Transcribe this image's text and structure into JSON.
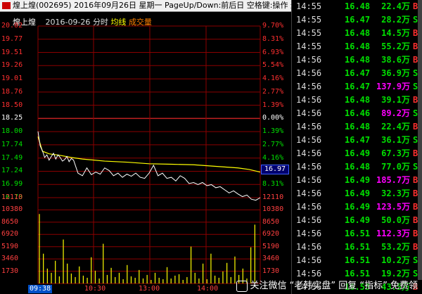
{
  "window": {
    "title": "煌上煌(002695) 2016年09月26日 星期一 PageUp/Down:前后日 空格键:操作 通达信(R)"
  },
  "chart_header": {
    "name": "煌上煌",
    "date": "2016-09-26",
    "mode": "分时",
    "ma_label": "均线",
    "vol_label": "成交量"
  },
  "current_price_label": "16.97",
  "colors": {
    "up": "#ff3030",
    "down": "#00e000",
    "flat": "#ffffff",
    "avg_line": "#ffff00",
    "price_line": "#ffffff",
    "grid": "#8b0000",
    "volume": "#ffff00",
    "purple": "#ff00ff"
  },
  "chart_data": {
    "type": "line",
    "title": "煌上煌 2016-09-26 分时",
    "x_ticks": [
      "09:38",
      "10:30",
      "13:00",
      "14:00"
    ],
    "price_axis": [
      "20.02",
      "19.77",
      "19.51",
      "19.26",
      "19.01",
      "18.76",
      "18.50",
      "18.25",
      "18.00",
      "17.74",
      "17.49",
      "17.24",
      "16.99",
      "16.73"
    ],
    "pct_axis": [
      "9.70%",
      "8.31%",
      "6.93%",
      "5.54%",
      "4.16%",
      "2.77%",
      "1.39%",
      "0.00%",
      "1.39%",
      "2.77%",
      "4.16%",
      "5.54%",
      "8.31%"
    ],
    "prev_close": 18.25,
    "ylim": [
      16.73,
      20.02
    ],
    "volume_axis": [
      "12110",
      "10380",
      "8650",
      "6920",
      "5190",
      "3460",
      "1730"
    ],
    "volume_ylim": [
      0,
      12110
    ],
    "series": [
      {
        "name": "均线",
        "x": [
          0,
          0.02,
          0.05,
          0.1,
          0.15,
          0.2,
          0.3,
          0.4,
          0.5,
          0.6,
          0.7,
          0.8,
          0.9,
          0.95,
          1.0
        ],
        "values": [
          17.9,
          17.62,
          17.57,
          17.54,
          17.5,
          17.47,
          17.43,
          17.41,
          17.38,
          17.37,
          17.36,
          17.33,
          17.3,
          17.27,
          17.22
        ]
      },
      {
        "name": "price",
        "x": [
          0,
          0.01,
          0.02,
          0.03,
          0.04,
          0.05,
          0.06,
          0.07,
          0.08,
          0.09,
          0.1,
          0.11,
          0.12,
          0.13,
          0.14,
          0.15,
          0.16,
          0.18,
          0.2,
          0.22,
          0.24,
          0.26,
          0.28,
          0.3,
          0.32,
          0.34,
          0.36,
          0.38,
          0.4,
          0.42,
          0.44,
          0.46,
          0.48,
          0.5,
          0.52,
          0.54,
          0.56,
          0.58,
          0.6,
          0.62,
          0.64,
          0.66,
          0.68,
          0.7,
          0.72,
          0.74,
          0.76,
          0.78,
          0.8,
          0.82,
          0.84,
          0.86,
          0.88,
          0.9,
          0.92,
          0.94,
          0.96,
          0.98,
          1.0
        ],
        "values": [
          18.0,
          17.72,
          17.63,
          17.5,
          17.55,
          17.45,
          17.52,
          17.58,
          17.47,
          17.55,
          17.5,
          17.43,
          17.46,
          17.52,
          17.42,
          17.48,
          17.45,
          17.2,
          17.15,
          17.3,
          17.17,
          17.22,
          17.18,
          17.3,
          17.25,
          17.15,
          17.2,
          17.12,
          17.18,
          17.14,
          17.2,
          17.12,
          17.1,
          17.2,
          17.35,
          17.15,
          17.2,
          17.1,
          17.12,
          17.05,
          17.15,
          17.1,
          17.0,
          17.02,
          16.98,
          17.02,
          16.96,
          16.98,
          16.92,
          16.94,
          16.88,
          16.82,
          16.86,
          16.8,
          16.75,
          16.78,
          16.7,
          16.68,
          16.73
        ]
      }
    ],
    "volume": [
      9800,
      4200,
      2100,
      1500,
      3200,
      1000,
      6200,
      2800,
      1400,
      900,
      2400,
      1100,
      800,
      3700,
      1800,
      700,
      5600,
      1200,
      2200,
      900,
      1500,
      600,
      2600,
      1000,
      800,
      1900,
      700,
      1200,
      500,
      1500,
      800,
      600,
      2300,
      700,
      1100,
      1300,
      500,
      900,
      5200,
      1500,
      700,
      2800,
      600,
      4200,
      1100,
      800,
      1700,
      2900,
      900,
      3800,
      1200,
      2100,
      700,
      5100,
      8300
    ],
    "grid": true
  },
  "ticks_panel": {
    "rows": [
      {
        "time": "14:55",
        "price": "16.48",
        "vol": "22.4万",
        "dir": "B",
        "vol_color": "#00e000",
        "dir_color": "#ff3030"
      },
      {
        "time": "14:55",
        "price": "16.47",
        "vol": "28.2万",
        "dir": "S",
        "vol_color": "#00e000",
        "dir_color": "#00e000"
      },
      {
        "time": "14:55",
        "price": "16.48",
        "vol": "14.5万",
        "dir": "B",
        "vol_color": "#00e000",
        "dir_color": "#ff3030"
      },
      {
        "time": "14:55",
        "price": "16.48",
        "vol": "55.2万",
        "dir": "B",
        "vol_color": "#00e000",
        "dir_color": "#ff3030"
      },
      {
        "time": "14:56",
        "price": "16.48",
        "vol": "38.6万",
        "dir": "B",
        "vol_color": "#00e000",
        "dir_color": "#ff3030"
      },
      {
        "time": "14:56",
        "price": "16.47",
        "vol": "36.9万",
        "dir": "S",
        "vol_color": "#00e000",
        "dir_color": "#00e000"
      },
      {
        "time": "14:56",
        "price": "16.47",
        "vol": "137.9万",
        "dir": "S",
        "vol_color": "#ff00ff",
        "dir_color": "#00e000"
      },
      {
        "time": "14:56",
        "price": "16.48",
        "vol": "39.1万",
        "dir": "B",
        "vol_color": "#00e000",
        "dir_color": "#ff3030"
      },
      {
        "time": "14:56",
        "price": "16.46",
        "vol": "89.2万",
        "dir": "S",
        "vol_color": "#ff00ff",
        "dir_color": "#00e000"
      },
      {
        "time": "14:56",
        "price": "16.48",
        "vol": "22.4万",
        "dir": "B",
        "vol_color": "#00e000",
        "dir_color": "#ff3030"
      },
      {
        "time": "14:56",
        "price": "16.47",
        "vol": "36.1万",
        "dir": "S",
        "vol_color": "#00e000",
        "dir_color": "#00e000"
      },
      {
        "time": "14:56",
        "price": "16.49",
        "vol": "67.3万",
        "dir": "B",
        "vol_color": "#00e000",
        "dir_color": "#ff3030"
      },
      {
        "time": "14:56",
        "price": "16.48",
        "vol": "77.0万",
        "dir": "S",
        "vol_color": "#00e000",
        "dir_color": "#00e000"
      },
      {
        "time": "14:56",
        "price": "16.49",
        "vol": "185.7万",
        "dir": "B",
        "vol_color": "#ff00ff",
        "dir_color": "#ff3030"
      },
      {
        "time": "14:56",
        "price": "16.49",
        "vol": "32.3万",
        "dir": "B",
        "vol_color": "#00e000",
        "dir_color": "#ff3030"
      },
      {
        "time": "14:56",
        "price": "16.49",
        "vol": "123.5万",
        "dir": "B",
        "vol_color": "#ff00ff",
        "dir_color": "#ff3030"
      },
      {
        "time": "14:56",
        "price": "16.49",
        "vol": "50.0万",
        "dir": "B",
        "vol_color": "#00e000",
        "dir_color": "#ff3030"
      },
      {
        "time": "14:56",
        "price": "16.51",
        "vol": "112.3万",
        "dir": "B",
        "vol_color": "#ff00ff",
        "dir_color": "#ff3030"
      },
      {
        "time": "14:56",
        "price": "16.51",
        "vol": "53.2万",
        "dir": "B",
        "vol_color": "#00e000",
        "dir_color": "#ff3030"
      },
      {
        "time": "14:56",
        "price": "16.51",
        "vol": "10.2万",
        "dir": "S",
        "vol_color": "#00e000",
        "dir_color": "#00e000"
      },
      {
        "time": "14:56",
        "price": "16.51",
        "vol": "19.2万",
        "dir": "S",
        "vol_color": "#00e000",
        "dir_color": "#00e000"
      },
      {
        "time": "14:56",
        "price": "16.53",
        "vol": "43.5万",
        "dir": "B",
        "vol_color": "#00e000",
        "dir_color": "#ff3030"
      }
    ]
  },
  "watermark": {
    "text": "关注微信 “老韩实盘” 回复 “指标” 免费领"
  }
}
